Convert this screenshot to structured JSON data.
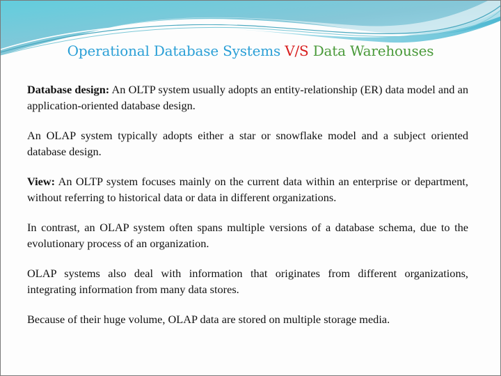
{
  "slide": {
    "title": {
      "part1": "Operational Database Systems ",
      "part2": "V/S",
      "part3": " Data Warehouses"
    },
    "paragraphs": [
      {
        "label": "Database design:",
        "text": "  An OLTP system usually adopts an entity-relationship (ER) data model and an application-oriented database design."
      },
      {
        "label": "",
        "text": "An OLAP system typically adopts either a star or snowflake model and a subject oriented database design."
      },
      {
        "label": "View:",
        "text": "  An OLTP system focuses mainly on the current data within an enterprise or department, without referring to historical data or data in different organizations."
      },
      {
        "label": "",
        "text": "In contrast, an OLAP system often spans multiple versions of a database schema, due to the evolutionary  process of an organization."
      },
      {
        "label": "",
        "text": "OLAP systems also deal with information that originates from different organizations, integrating information from many data stores."
      },
      {
        "label": "",
        "text": "Because of their huge volume, OLAP data are stored on multiple storage media."
      }
    ],
    "colors": {
      "title_blue": "#2a9fd6",
      "title_red": "#d81f1f",
      "title_green": "#4a9a3a",
      "wave_top": "#7fc3d6",
      "wave_light": "#a8dcea"
    }
  }
}
